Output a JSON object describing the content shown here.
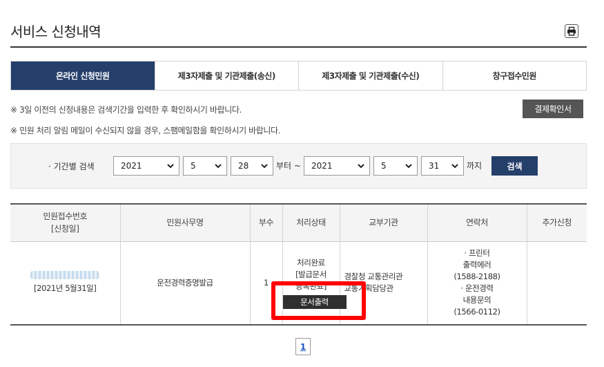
{
  "header": {
    "title": "서비스 신청내역",
    "print_icon": "printer-icon"
  },
  "tabs": [
    {
      "label": "온라인 신청민원",
      "active": true
    },
    {
      "label": "제3자제출 및 기관제출(송신)",
      "active": false
    },
    {
      "label": "제3자제출 및 기관제출(수신)",
      "active": false
    },
    {
      "label": "창구접수민원",
      "active": false
    }
  ],
  "notices": [
    "※ 3일 이전의 신청내용은 검색기간을 입력한 후 확인하시기 바랍니다.",
    "※ 민원 처리 알림 메일이 수신되지 않을 경우, 스팸메일함을 확인하시기 바랍니다."
  ],
  "receipt_button": "결제확인서",
  "search": {
    "label": "· 기간별 검색",
    "from": {
      "year": "2021",
      "month": "5",
      "day": "28"
    },
    "from_suffix": "부터 ~",
    "to": {
      "year": "2021",
      "month": "5",
      "day": "31"
    },
    "to_suffix": "까지",
    "button": "검색"
  },
  "table": {
    "headers": [
      "민원접수번호\n[신청일]",
      "민원사무명",
      "부수",
      "처리상태",
      "교부기관",
      "연락처",
      "추가신청"
    ],
    "rows": [
      {
        "receipt_no_hidden": true,
        "apply_date": "[2021년 5월31일]",
        "name": "운전경력증명발급",
        "copies": "1",
        "status_line1": "처리완료",
        "status_line2": "[발급문서",
        "status_line3": "등록완료]",
        "action_button": "문서출력",
        "agency_line1": "경찰청 교통관리관",
        "agency_line2": "교통기획담당관",
        "contact": [
          "· 프린터",
          "출력에러",
          "(1588-2188)",
          "· 운전경력",
          "내용문의",
          "(1566-0112)"
        ],
        "extra": ""
      }
    ]
  },
  "pagination": {
    "current": "1"
  },
  "colors": {
    "primary": "#253f6b",
    "highlight": "#ff0000",
    "dark_button": "#2f2f2f"
  }
}
